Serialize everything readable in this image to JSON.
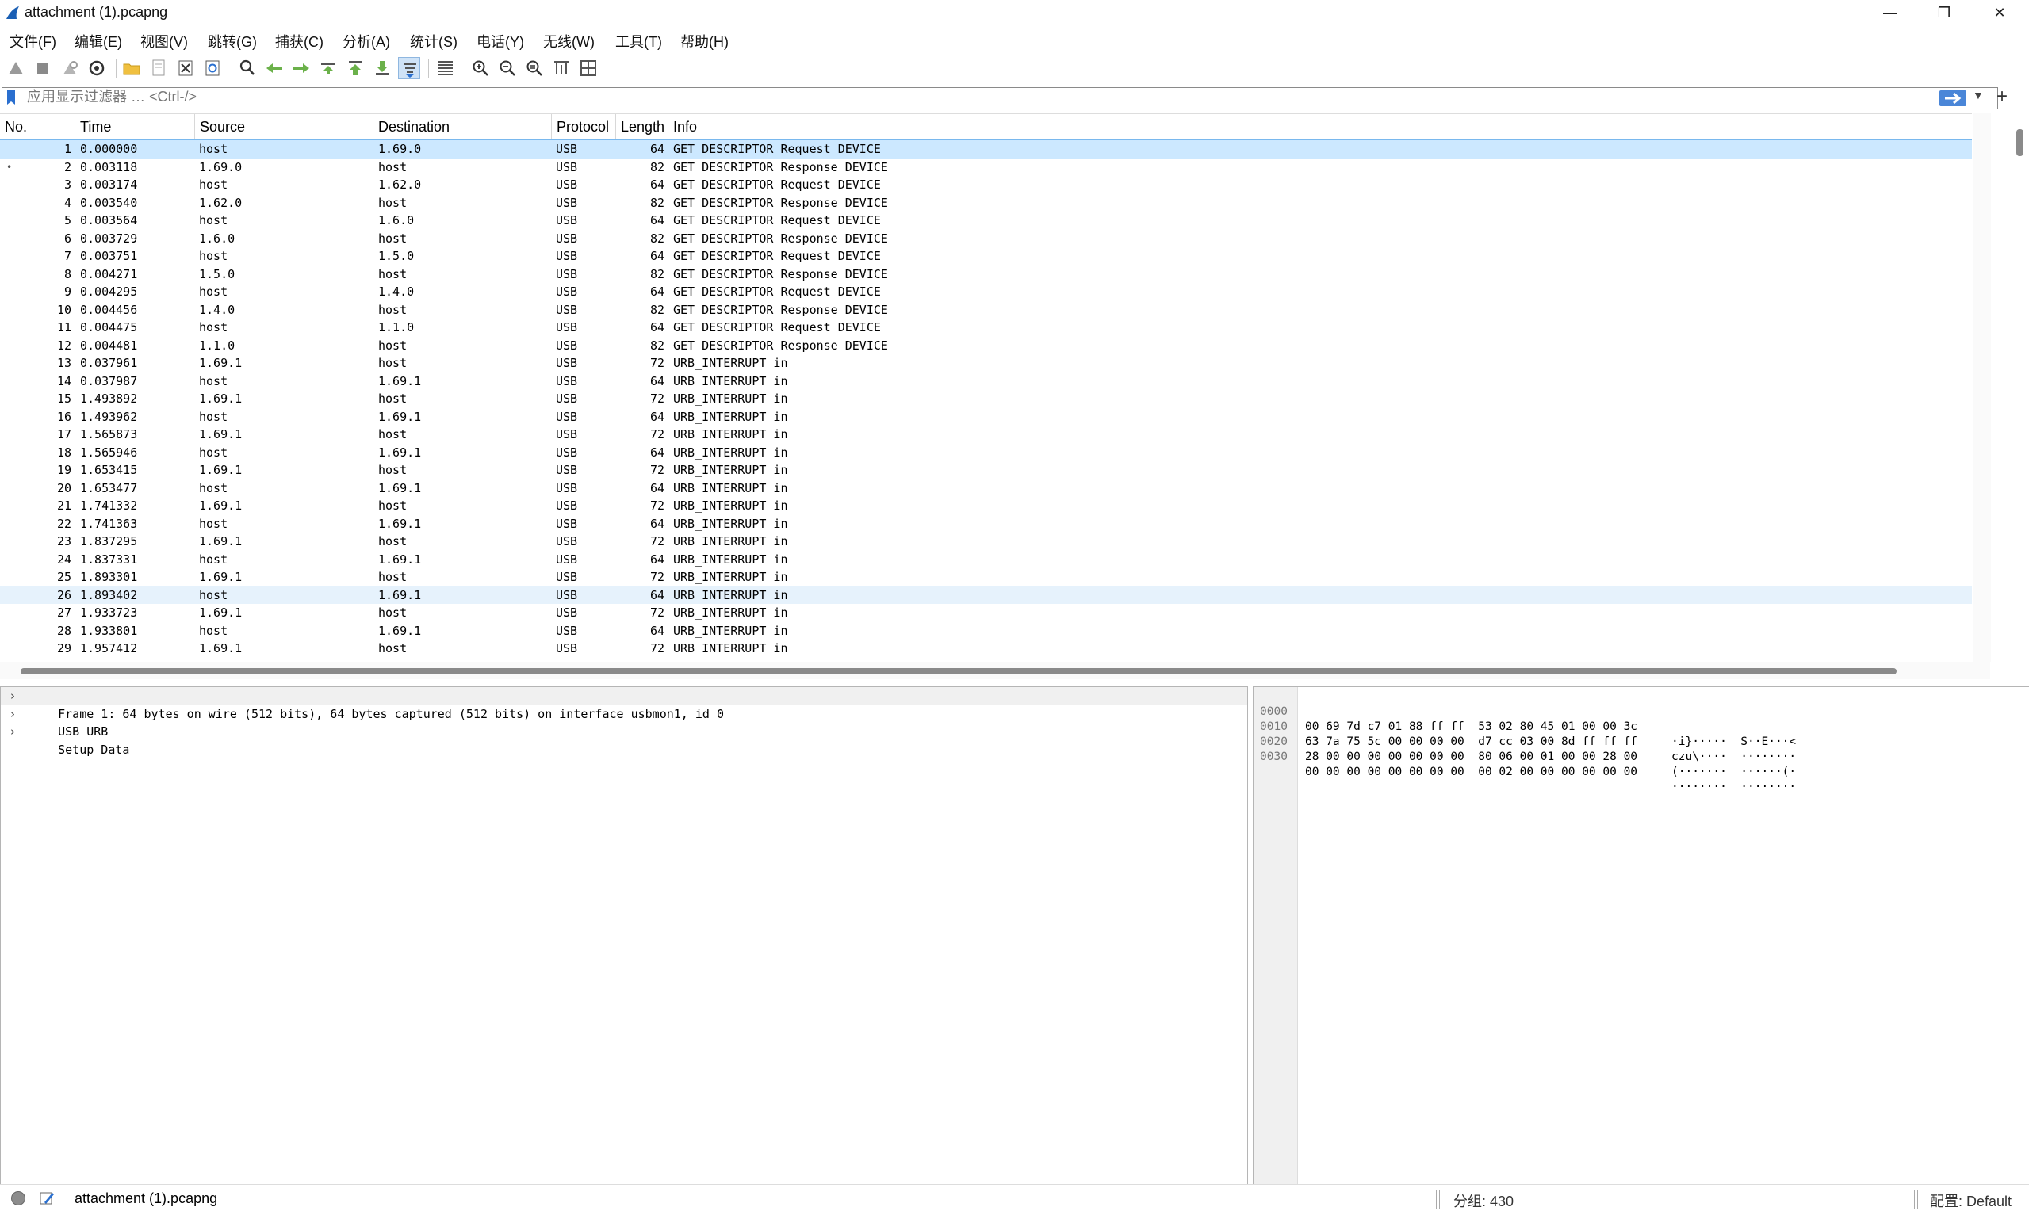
{
  "window": {
    "title": "attachment (1).pcapng",
    "minimize": "—",
    "restore": "❐",
    "close": "✕"
  },
  "menu": [
    "文件(F)",
    "编辑(E)",
    "视图(V)",
    "跳转(G)",
    "捕获(C)",
    "分析(A)",
    "统计(S)",
    "电话(Y)",
    "无线(W)",
    "工具(T)",
    "帮助(H)"
  ],
  "toolbar_icons": [
    "start-capture-icon",
    "stop-capture-icon",
    "restart-capture-icon",
    "capture-options-icon",
    "open-file-icon",
    "open-recent-icon",
    "close-file-icon",
    "reload-file-icon",
    "find-packet-icon",
    "go-back-icon",
    "go-forward-icon",
    "go-to-packet-icon",
    "go-first-icon",
    "go-last-icon",
    "auto-scroll-icon",
    "colorize-icon",
    "zoom-in-icon",
    "zoom-out-icon",
    "normal-size-icon",
    "resize-columns-icon",
    "layout-icon"
  ],
  "filter": {
    "placeholder": "应用显示过滤器 … <Ctrl-/>",
    "value": ""
  },
  "packet_list": {
    "columns": [
      "No.",
      "Time",
      "Source",
      "Destination",
      "Protocol",
      "Length",
      "Info"
    ],
    "rows": [
      {
        "no": "1",
        "time": "0.000000",
        "src": "host",
        "dst": "1.69.0",
        "proto": "USB",
        "len": "64",
        "info": "GET DESCRIPTOR Request DEVICE"
      },
      {
        "no": "2",
        "time": "0.003118",
        "src": "1.69.0",
        "dst": "host",
        "proto": "USB",
        "len": "82",
        "info": "GET DESCRIPTOR Response DEVICE"
      },
      {
        "no": "3",
        "time": "0.003174",
        "src": "host",
        "dst": "1.62.0",
        "proto": "USB",
        "len": "64",
        "info": "GET DESCRIPTOR Request DEVICE"
      },
      {
        "no": "4",
        "time": "0.003540",
        "src": "1.62.0",
        "dst": "host",
        "proto": "USB",
        "len": "82",
        "info": "GET DESCRIPTOR Response DEVICE"
      },
      {
        "no": "5",
        "time": "0.003564",
        "src": "host",
        "dst": "1.6.0",
        "proto": "USB",
        "len": "64",
        "info": "GET DESCRIPTOR Request DEVICE"
      },
      {
        "no": "6",
        "time": "0.003729",
        "src": "1.6.0",
        "dst": "host",
        "proto": "USB",
        "len": "82",
        "info": "GET DESCRIPTOR Response DEVICE"
      },
      {
        "no": "7",
        "time": "0.003751",
        "src": "host",
        "dst": "1.5.0",
        "proto": "USB",
        "len": "64",
        "info": "GET DESCRIPTOR Request DEVICE"
      },
      {
        "no": "8",
        "time": "0.004271",
        "src": "1.5.0",
        "dst": "host",
        "proto": "USB",
        "len": "82",
        "info": "GET DESCRIPTOR Response DEVICE"
      },
      {
        "no": "9",
        "time": "0.004295",
        "src": "host",
        "dst": "1.4.0",
        "proto": "USB",
        "len": "64",
        "info": "GET DESCRIPTOR Request DEVICE"
      },
      {
        "no": "10",
        "time": "0.004456",
        "src": "1.4.0",
        "dst": "host",
        "proto": "USB",
        "len": "82",
        "info": "GET DESCRIPTOR Response DEVICE"
      },
      {
        "no": "11",
        "time": "0.004475",
        "src": "host",
        "dst": "1.1.0",
        "proto": "USB",
        "len": "64",
        "info": "GET DESCRIPTOR Request DEVICE"
      },
      {
        "no": "12",
        "time": "0.004481",
        "src": "1.1.0",
        "dst": "host",
        "proto": "USB",
        "len": "82",
        "info": "GET DESCRIPTOR Response DEVICE"
      },
      {
        "no": "13",
        "time": "0.037961",
        "src": "1.69.1",
        "dst": "host",
        "proto": "USB",
        "len": "72",
        "info": "URB_INTERRUPT in"
      },
      {
        "no": "14",
        "time": "0.037987",
        "src": "host",
        "dst": "1.69.1",
        "proto": "USB",
        "len": "64",
        "info": "URB_INTERRUPT in"
      },
      {
        "no": "15",
        "time": "1.493892",
        "src": "1.69.1",
        "dst": "host",
        "proto": "USB",
        "len": "72",
        "info": "URB_INTERRUPT in"
      },
      {
        "no": "16",
        "time": "1.493962",
        "src": "host",
        "dst": "1.69.1",
        "proto": "USB",
        "len": "64",
        "info": "URB_INTERRUPT in"
      },
      {
        "no": "17",
        "time": "1.565873",
        "src": "1.69.1",
        "dst": "host",
        "proto": "USB",
        "len": "72",
        "info": "URB_INTERRUPT in"
      },
      {
        "no": "18",
        "time": "1.565946",
        "src": "host",
        "dst": "1.69.1",
        "proto": "USB",
        "len": "64",
        "info": "URB_INTERRUPT in"
      },
      {
        "no": "19",
        "time": "1.653415",
        "src": "1.69.1",
        "dst": "host",
        "proto": "USB",
        "len": "72",
        "info": "URB_INTERRUPT in"
      },
      {
        "no": "20",
        "time": "1.653477",
        "src": "host",
        "dst": "1.69.1",
        "proto": "USB",
        "len": "64",
        "info": "URB_INTERRUPT in"
      },
      {
        "no": "21",
        "time": "1.741332",
        "src": "1.69.1",
        "dst": "host",
        "proto": "USB",
        "len": "72",
        "info": "URB_INTERRUPT in"
      },
      {
        "no": "22",
        "time": "1.741363",
        "src": "host",
        "dst": "1.69.1",
        "proto": "USB",
        "len": "64",
        "info": "URB_INTERRUPT in"
      },
      {
        "no": "23",
        "time": "1.837295",
        "src": "1.69.1",
        "dst": "host",
        "proto": "USB",
        "len": "72",
        "info": "URB_INTERRUPT in"
      },
      {
        "no": "24",
        "time": "1.837331",
        "src": "host",
        "dst": "1.69.1",
        "proto": "USB",
        "len": "64",
        "info": "URB_INTERRUPT in"
      },
      {
        "no": "25",
        "time": "1.893301",
        "src": "1.69.1",
        "dst": "host",
        "proto": "USB",
        "len": "72",
        "info": "URB_INTERRUPT in"
      },
      {
        "no": "26",
        "time": "1.893402",
        "src": "host",
        "dst": "1.69.1",
        "proto": "USB",
        "len": "64",
        "info": "URB_INTERRUPT in"
      },
      {
        "no": "27",
        "time": "1.933723",
        "src": "1.69.1",
        "dst": "host",
        "proto": "USB",
        "len": "72",
        "info": "URB_INTERRUPT in"
      },
      {
        "no": "28",
        "time": "1.933801",
        "src": "host",
        "dst": "1.69.1",
        "proto": "USB",
        "len": "64",
        "info": "URB_INTERRUPT in"
      },
      {
        "no": "29",
        "time": "1.957412",
        "src": "1.69.1",
        "dst": "host",
        "proto": "USB",
        "len": "72",
        "info": "URB_INTERRUPT in"
      }
    ],
    "selected_row": "1",
    "hover_row": "26",
    "related_mark_row": "2"
  },
  "details": [
    "Frame 1: 64 bytes on wire (512 bits), 64 bytes captured (512 bits) on interface usbmon1, id 0",
    "USB URB",
    "Setup Data"
  ],
  "bytes": [
    {
      "offset": "0000",
      "hex": "00 69 7d c7 01 88 ff ff  53 02 80 45 01 00 00 3c",
      "ascii": "·i}·····  S··E···<"
    },
    {
      "offset": "0010",
      "hex": "63 7a 75 5c 00 00 00 00  d7 cc 03 00 8d ff ff ff",
      "ascii": "czu\\····  ········"
    },
    {
      "offset": "0020",
      "hex": "28 00 00 00 00 00 00 00  80 06 00 01 00 00 28 00",
      "ascii": "(·······  ······(·"
    },
    {
      "offset": "0030",
      "hex": "00 00 00 00 00 00 00 00  00 02 00 00 00 00 00 00",
      "ascii": "········  ········"
    }
  ],
  "status": {
    "file": "attachment (1).pcapng",
    "packets": "分组: 430",
    "profile": "配置: Default"
  },
  "colors": {
    "selected_row": "#cce8ff",
    "hover_row": "#e6f2fc",
    "accent": "#4a86d8"
  }
}
